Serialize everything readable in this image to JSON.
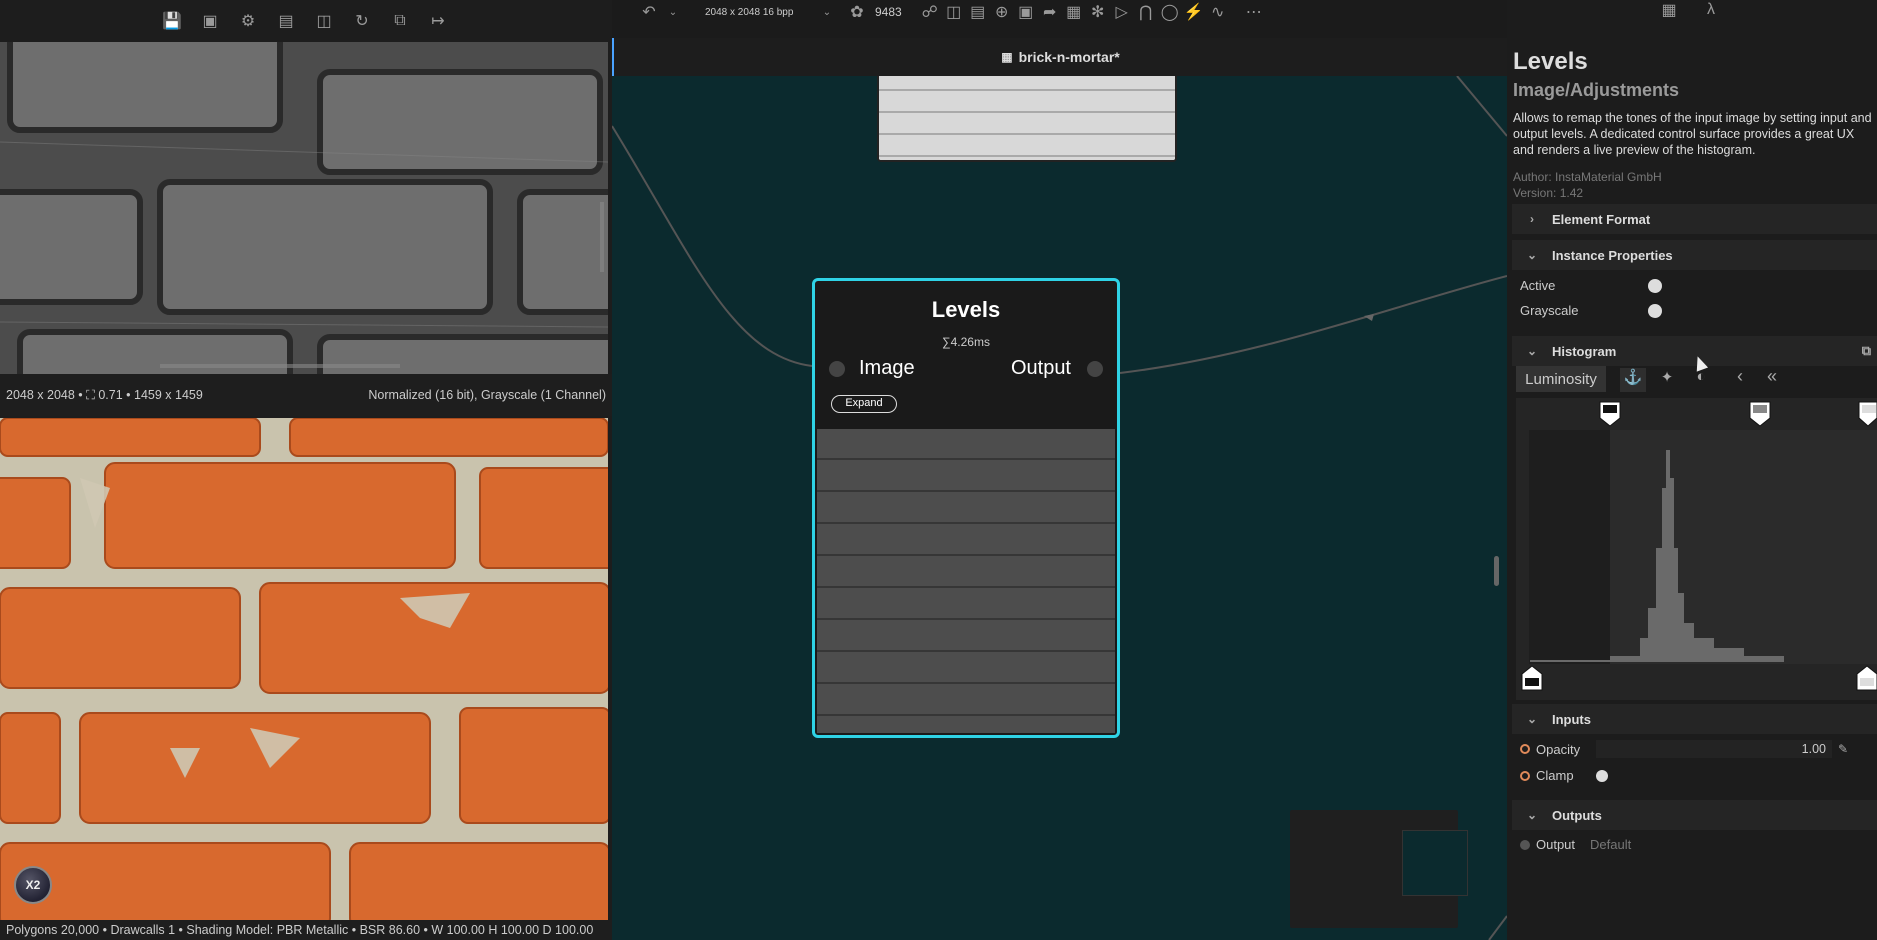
{
  "left_toolbar": {
    "icons": [
      "save-icon",
      "package-icon",
      "gear-icon",
      "image-icon",
      "cube-icon",
      "refresh-icon",
      "windows-icon",
      "exit-icon"
    ]
  },
  "viewer1": {
    "info_left": "2048 x 2048 • ⛶ 0.71 • 1459 x 1459",
    "info_right": "Normalized (16 bit), Grayscale (1 Channel)"
  },
  "viewer2": {
    "logo": "X2",
    "status": "Polygons 20,000 • Drawcalls 1 • Shading Model: PBR Metallic • BSR 86.60 • W 100.00 H 100.00 D 100.00"
  },
  "center_toolbar": {
    "resolution": "2048 x 2048 16 bpp",
    "seed": "9483"
  },
  "graph": {
    "tab_title": "brick-n-mortar*",
    "node": {
      "title": "Levels",
      "timing": "∑4.26ms",
      "input_label": "Image",
      "output_label": "Output",
      "expand_label": "Expand"
    }
  },
  "inspector": {
    "title": "Levels",
    "subtitle": "Image/Adjustments",
    "description": "Allows to remap the tones of the input image by setting input and output levels. A dedicated control surface provides a great UX and renders a live preview of the histogram.",
    "author": "Author: InstaMaterial GmbH",
    "version": "Version: 1.42",
    "sections": {
      "element_format": "Element Format",
      "instance_properties": "Instance Properties",
      "histogram": "Histogram",
      "inputs": "Inputs",
      "outputs": "Outputs"
    },
    "instance": {
      "active_label": "Active",
      "grayscale_label": "Grayscale"
    },
    "histogram": {
      "channel": "Luminosity"
    },
    "inputs": {
      "opacity_label": "Opacity",
      "opacity_value": "1.00",
      "clamp_label": "Clamp"
    },
    "outputs": {
      "output_label": "Output",
      "output_value": "Default"
    }
  },
  "colors": {
    "graph_bg": "#0b2a2e",
    "node_border": "#2fd3e6",
    "panel_bg": "#1c1c1c"
  }
}
